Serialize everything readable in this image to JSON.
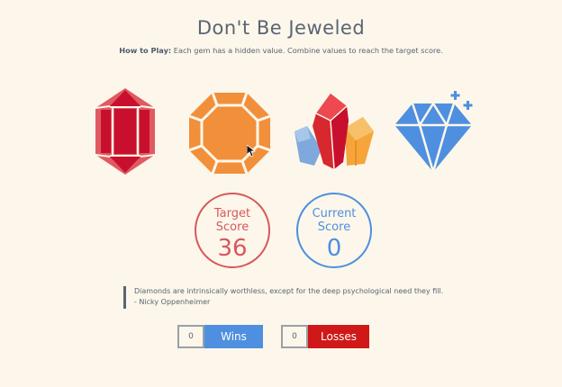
{
  "header": {
    "title": "Don't Be Jeweled",
    "howto_label": "How to Play:",
    "howto_text": " Each gem has a hidden value. Combine values to reach the target score."
  },
  "gems": [
    {
      "name": "red-gem",
      "color": "#d7272f",
      "icon": "red-crystal-icon"
    },
    {
      "name": "orange-gem",
      "color": "#f28f3b",
      "icon": "orange-octagon-icon"
    },
    {
      "name": "crystal-cluster",
      "color": "#e8323c",
      "icon": "crystal-cluster-icon"
    },
    {
      "name": "blue-diamond",
      "color": "#4e8fe0",
      "icon": "diamond-icon"
    }
  ],
  "scores": {
    "target_label_line1": "Target",
    "target_label_line2": "Score",
    "target_value": "36",
    "current_label_line1": "Current",
    "current_label_line2": "Score",
    "current_value": "0"
  },
  "quote": {
    "text": "Diamonds are intrinsically worthless, except for the deep psychological need they fill.",
    "author": "- Nicky Oppenheimer"
  },
  "counters": {
    "wins_count": "0",
    "wins_label": "Wins",
    "losses_count": "0",
    "losses_label": "Losses"
  },
  "colors": {
    "background": "#fcf7ea",
    "target": "#d9575f",
    "current": "#4e8fe0",
    "wins": "#4e8fe0",
    "losses": "#d01818"
  }
}
